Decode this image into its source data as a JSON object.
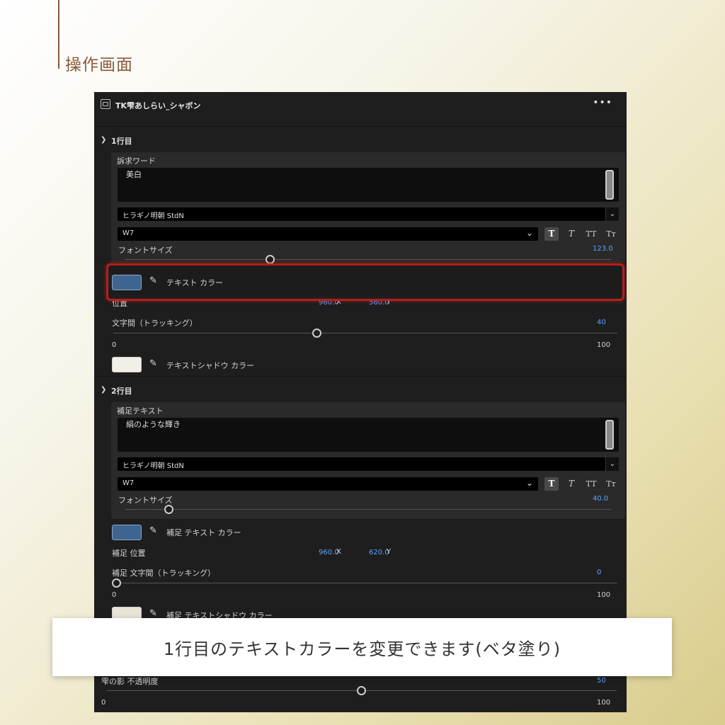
{
  "page": {
    "heading": "操作画面",
    "caption": "1行目のテキストカラーを変更できます(ベタ塗り)"
  },
  "panel": {
    "title": "TK雫あしらい_シャボン",
    "menu_icon": "more-horizontal-icon",
    "section1": {
      "header": "1行目",
      "group_label": "訴求ワード",
      "text_value": "美白",
      "font_family": "ヒラギノ明朝 StdN",
      "font_weight": "W7",
      "styles": [
        "T",
        "T",
        "TT",
        "Tт"
      ],
      "font_size_label": "フォントサイズ",
      "font_size_value": "123.0",
      "color_label": "テキスト カラー",
      "color": "#3e6590",
      "position_label": "位置",
      "pos_x": "960.0",
      "pos_y": "560.0",
      "x_unit": "X",
      "y_unit": "Y",
      "tracking_label": "文字間（トラッキング）",
      "tracking_value": "40",
      "tracking_min": "0",
      "tracking_max": "100",
      "shadow_label": "テキストシャドウ カラー",
      "shadow_color": "#f2efe6"
    },
    "section2": {
      "header": "2行目",
      "group_label": "補足テキスト",
      "text_value": "絹のような輝き",
      "font_family": "ヒラギノ明朝 StdN",
      "font_weight": "W7",
      "styles": [
        "T",
        "T",
        "TT",
        "Tт"
      ],
      "font_size_label": "フォントサイズ",
      "font_size_value": "40.0",
      "color_label": "補足 テキスト カラー",
      "color": "#3e6590",
      "position_label": "補足 位置",
      "pos_x": "960.0",
      "pos_y": "620.0",
      "x_unit": "X",
      "y_unit": "Y",
      "tracking_label": "補足 文字間（トラッキング）",
      "tracking_value": "0",
      "tracking_min": "0",
      "tracking_max": "100",
      "shadow_label": "補足 テキストシャドウ カラー",
      "shadow_color": "#e8e4d8"
    },
    "bottom": {
      "opacity_label": "雫の影 不透明度",
      "opacity_value": "50",
      "opacity_min": "0",
      "opacity_max": "100"
    }
  }
}
